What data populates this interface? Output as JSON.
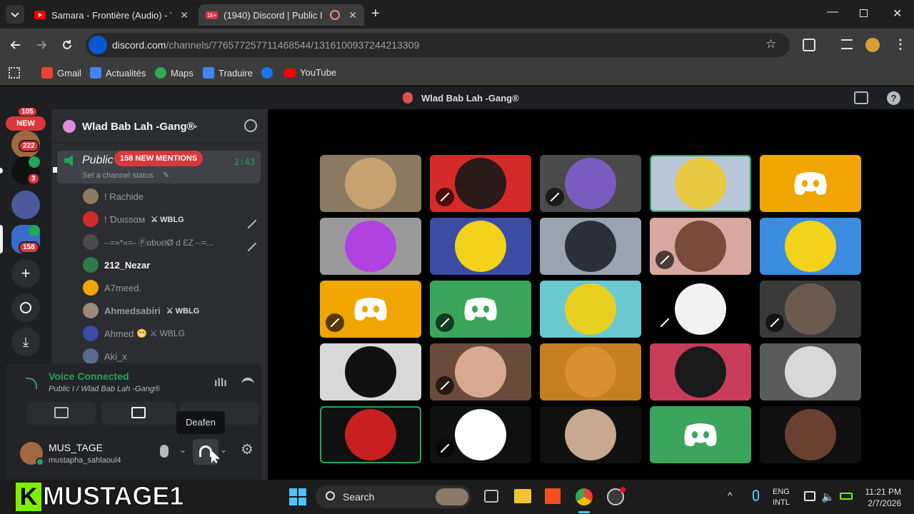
{
  "browser": {
    "tabs": [
      {
        "title": "Samara - Frontière (Audio) - Yo",
        "icon": "youtube-icon"
      },
      {
        "title": "(1940) Discord | Public I",
        "badge": "1k+",
        "icon": "discord-icon"
      }
    ],
    "url_host": "discord.com",
    "url_path": "/channels/776577257711468544/1316100937244213309",
    "bookmarks": [
      "Gmail",
      "Actualités",
      "Maps",
      "Traduire",
      "YouTube"
    ]
  },
  "discord": {
    "title": "Wlad Bab Lah -Gang®",
    "server_name": "Wlad Bab Lah -Gang®",
    "guild_badges": {
      "top_count": "105",
      "new_label": "NEW",
      "count_222": "222",
      "count_3": "3",
      "count_158": "158"
    },
    "channel": {
      "name": "Public",
      "mentions_badge": "158 NEW MENTIONS",
      "time": "2:43",
      "status_placeholder": "Set a channel status"
    },
    "members": [
      {
        "name": "! Rachide",
        "tag": "",
        "muted": false,
        "bold": false
      },
      {
        "name": "! Ɗυιѕѕαм",
        "tag": "WBLG",
        "muted": true,
        "bold": false
      },
      {
        "name": "-·=»*«=- ⓅαbυεłØ d ƐZ -·=...",
        "tag": "",
        "muted": true,
        "bold": false
      },
      {
        "name": "212_Nezar",
        "tag": "",
        "muted": false,
        "bold": true
      },
      {
        "name": "A7meed.",
        "tag": "",
        "muted": false,
        "bold": false
      },
      {
        "name": "Ahmedsabiri",
        "tag": "WBLG",
        "muted": false,
        "bold": false
      },
      {
        "name": "Ahmed",
        "tag": "WBLG",
        "muted": false,
        "bold": false
      },
      {
        "name": "Aki_x",
        "tag": "",
        "muted": false,
        "bold": false
      }
    ],
    "voice": {
      "status": "Voice Connected",
      "channel_path": "Public I  / Wlad Bab Lah -Gang®",
      "tooltip": "Deafen"
    },
    "user": {
      "display_name": "MUS_TAGE",
      "username": "mustapha_sahlaoul4"
    },
    "tiles": [
      {
        "bg": "#8a7a62",
        "kind": "photo",
        "muted": false,
        "fill": "#c9a070"
      },
      {
        "bg": "#d42a2a",
        "kind": "photo",
        "muted": true,
        "fill": "#2a1a18"
      },
      {
        "bg": "#4a4a4a",
        "kind": "photo",
        "muted": true,
        "fill": "#7a5cc0"
      },
      {
        "bg": "#b8c6da",
        "kind": "photo",
        "muted": false,
        "fill": "#e8c840",
        "speaking": true
      },
      {
        "bg": "#f0a500",
        "kind": "discord",
        "muted": false
      },
      {
        "bg": "#9a9a9a",
        "kind": "photo",
        "muted": false,
        "fill": "#b042e0"
      },
      {
        "bg": "#3c4ba4",
        "kind": "photo",
        "muted": false,
        "fill": "#f2d21a"
      },
      {
        "bg": "#9aa4b0",
        "kind": "photo",
        "muted": false,
        "fill": "#2a3038"
      },
      {
        "bg": "#d8a8a0",
        "kind": "photo",
        "muted": true,
        "fill": "#7a4a3a"
      },
      {
        "bg": "#3c8ce0",
        "kind": "photo",
        "muted": false,
        "fill": "#f2d21a"
      },
      {
        "bg": "#f0a500",
        "kind": "discord",
        "muted": true
      },
      {
        "bg": "#3ba55c",
        "kind": "discord",
        "muted": true
      },
      {
        "bg": "#6ac8d0",
        "kind": "photo",
        "muted": false,
        "fill": "#e8d020"
      },
      {
        "bg": "#000000",
        "kind": "photo",
        "muted": true,
        "fill": "#f2f2f2"
      },
      {
        "bg": "#3a3a3a",
        "kind": "photo",
        "muted": true,
        "fill": "#6a5a50"
      },
      {
        "bg": "#d8d8d8",
        "kind": "photo",
        "muted": false,
        "fill": "#111111"
      },
      {
        "bg": "#6a4a3a",
        "kind": "photo",
        "muted": true,
        "fill": "#d8a890"
      },
      {
        "bg": "#c47f20",
        "kind": "photo",
        "muted": false,
        "fill": "#d89030"
      },
      {
        "bg": "#c83c5a",
        "kind": "photo",
        "muted": false,
        "fill": "#1a1a1a"
      },
      {
        "bg": "#5a5a5a",
        "kind": "photo",
        "muted": false,
        "fill": "#d8d8d8"
      },
      {
        "bg": "#101010",
        "kind": "photo",
        "muted": false,
        "fill": "#c82020",
        "speaking": true
      },
      {
        "bg": "#101010",
        "kind": "photo",
        "muted": true,
        "fill": "#ffffff"
      },
      {
        "bg": "#101010",
        "kind": "photo",
        "muted": false,
        "fill": "#c8a890"
      },
      {
        "bg": "#3ba55c",
        "kind": "discord",
        "muted": false
      },
      {
        "bg": "#101010",
        "kind": "photo",
        "muted": false,
        "fill": "#6a4030"
      }
    ]
  },
  "taskbar": {
    "overlay_text": "MUSTAGE1",
    "search_label": "Search",
    "lang_line1": "ENG",
    "lang_line2": "INTL",
    "time": "11:21 PM",
    "date": "2/7/2026"
  },
  "colors": {
    "accent_green": "#23a55a",
    "voice_green": "#43b581",
    "mention_red": "#da373c",
    "discord_blurple": "#5865f2"
  }
}
